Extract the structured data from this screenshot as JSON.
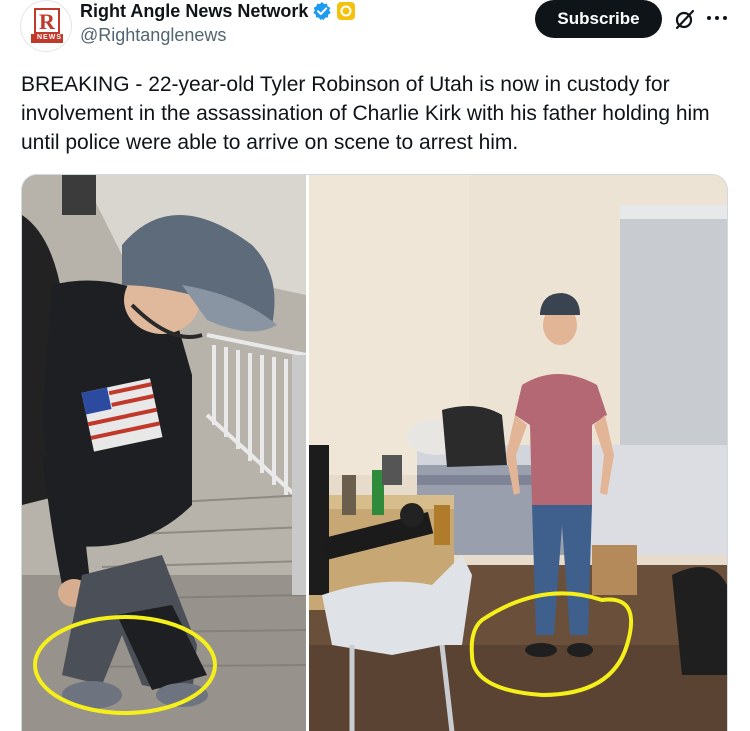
{
  "account": {
    "display_name": "Right Angle News Network",
    "handle": "@Rightanglenews",
    "avatar_text": "R",
    "avatar_subtext": "NEWS"
  },
  "actions": {
    "subscribe_label": "Subscribe",
    "grok_icon": "grok-slash-circle-icon",
    "more_icon": "more-horizontal-icon"
  },
  "tweet": {
    "text": "BREAKING - 22-year-old Tyler Robinson of Utah is now in custody for involvement in the assassination of Charlie Kirk with his father holding him until police were able to arrive on scene to arrest him."
  },
  "colors": {
    "verified": "#1d9bf0",
    "affiliate_badge": "#f4c20d",
    "subscribe_bg": "#0f1419",
    "highlight_circle": "#f5ef1a"
  }
}
